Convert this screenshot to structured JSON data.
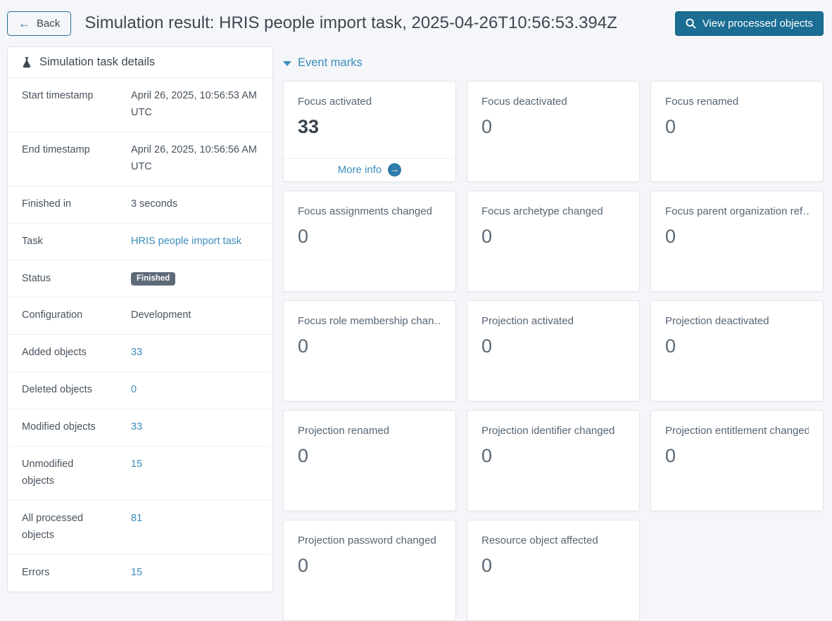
{
  "header": {
    "back_label": "Back",
    "title": "Simulation result: HRIS people import task, 2025-04-26T10:56:53.394Z",
    "view_processed_label": "View processed objects"
  },
  "details_panel": {
    "title": "Simulation task details",
    "rows": [
      {
        "label": "Start timestamp",
        "value": "April 26, 2025, 10:56:53 AM UTC",
        "type": "text"
      },
      {
        "label": "End timestamp",
        "value": "April 26, 2025, 10:56:56 AM UTC",
        "type": "text"
      },
      {
        "label": "Finished in",
        "value": "3 seconds",
        "type": "text"
      },
      {
        "label": "Task",
        "value": "HRIS people import task",
        "type": "link"
      },
      {
        "label": "Status",
        "value": "Finished",
        "type": "badge"
      },
      {
        "label": "Configuration",
        "value": "Development",
        "type": "text"
      },
      {
        "label": "Added objects",
        "value": "33",
        "type": "link"
      },
      {
        "label": "Deleted objects",
        "value": "0",
        "type": "link"
      },
      {
        "label": "Modified objects",
        "value": "33",
        "type": "link"
      },
      {
        "label": "Unmodified objects",
        "value": "15",
        "type": "link"
      },
      {
        "label": "All processed objects",
        "value": "81",
        "type": "link"
      },
      {
        "label": "Errors",
        "value": "15",
        "type": "link"
      }
    ]
  },
  "event_marks": {
    "title": "Event marks",
    "more_info_label": "More info",
    "cards": [
      {
        "label": "Focus activated",
        "value": "33",
        "highlight": true,
        "more_info": true
      },
      {
        "label": "Focus deactivated",
        "value": "0",
        "highlight": false,
        "more_info": false
      },
      {
        "label": "Focus renamed",
        "value": "0",
        "highlight": false,
        "more_info": false
      },
      {
        "label": "Focus assignments changed",
        "value": "0",
        "highlight": false,
        "more_info": false
      },
      {
        "label": "Focus archetype changed",
        "value": "0",
        "highlight": false,
        "more_info": false
      },
      {
        "label": "Focus parent organization ref…",
        "value": "0",
        "highlight": false,
        "more_info": false
      },
      {
        "label": "Focus role membership chan…",
        "value": "0",
        "highlight": false,
        "more_info": false
      },
      {
        "label": "Projection activated",
        "value": "0",
        "highlight": false,
        "more_info": false
      },
      {
        "label": "Projection deactivated",
        "value": "0",
        "highlight": false,
        "more_info": false
      },
      {
        "label": "Projection renamed",
        "value": "0",
        "highlight": false,
        "more_info": false
      },
      {
        "label": "Projection identifier changed",
        "value": "0",
        "highlight": false,
        "more_info": false
      },
      {
        "label": "Projection entitlement changed",
        "value": "0",
        "highlight": false,
        "more_info": false
      },
      {
        "label": "Projection password changed",
        "value": "0",
        "highlight": false,
        "more_info": false
      },
      {
        "label": "Resource object affected",
        "value": "0",
        "highlight": false,
        "more_info": false
      }
    ]
  },
  "icons": {
    "back": "arrow-left-icon",
    "view_processed": "search-icon",
    "details_header": "flask-icon",
    "event_marks_toggle": "caret-down-icon",
    "more_info": "arrow-circle-right-icon"
  },
  "colors": {
    "page_background": "#f4f6f9",
    "link_blue": "#3c8dbc",
    "primary_button": "#1b6d93",
    "status_badge_gray": "#5f6a78",
    "title_text": "#3d4852"
  }
}
